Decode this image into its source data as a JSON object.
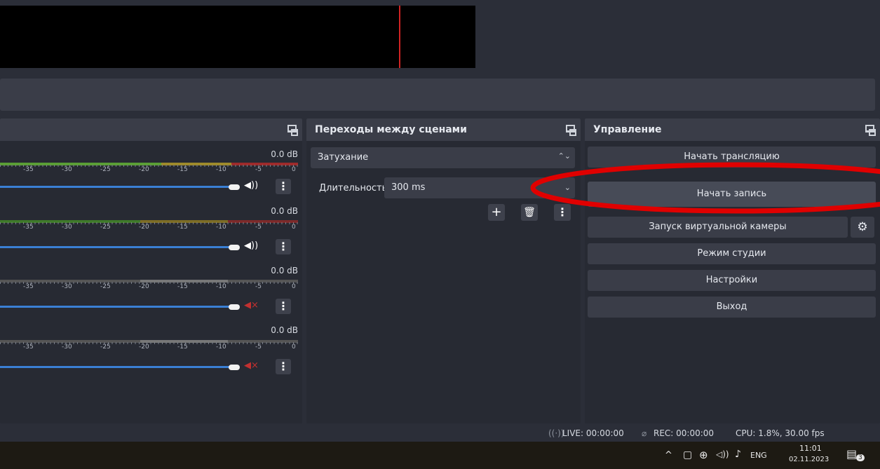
{
  "mixer": {
    "channels": [
      {
        "db": "0.0 dB",
        "muted": false
      },
      {
        "db": "0.0 dB",
        "muted": false
      },
      {
        "db": "0.0 dB",
        "muted": true
      },
      {
        "db": "0.0 dB",
        "muted": true
      }
    ],
    "scale_labels": [
      "-35",
      "-30",
      "-25",
      "-20",
      "-15",
      "-10",
      "-5",
      "0"
    ]
  },
  "transitions": {
    "title": "Переходы между сценами",
    "transition_value": "Затухание",
    "duration_label": "Длительность",
    "duration_value": "300 ms"
  },
  "controls": {
    "title": "Управление",
    "start_streaming": "Начать трансляцию",
    "start_recording": "Начать запись",
    "start_virtual_camera": "Запуск виртуальной камеры",
    "studio_mode": "Режим студии",
    "settings": "Настройки",
    "exit": "Выход"
  },
  "status": {
    "live": "LIVE: 00:00:00",
    "rec": "REC: 00:00:00",
    "cpu": "CPU: 1.8%, 30.00 fps"
  },
  "taskbar": {
    "language": "ENG",
    "time": "11:01",
    "date": "02.11.2023",
    "notification_count": "3"
  },
  "colors": {
    "accent_blue": "#3a7fd4",
    "annotation_red": "#e00000",
    "meter_green": "#5a9e35",
    "meter_yellow": "#9e8a2a",
    "meter_red": "#9e2a2a"
  },
  "icons": [
    "float-dock-icon",
    "speaker-icon",
    "speaker-muted-icon",
    "kebab-menu-icon",
    "plus-icon",
    "trash-icon",
    "gear-icon",
    "updown-caret-icon",
    "chevron-down-icon"
  ]
}
